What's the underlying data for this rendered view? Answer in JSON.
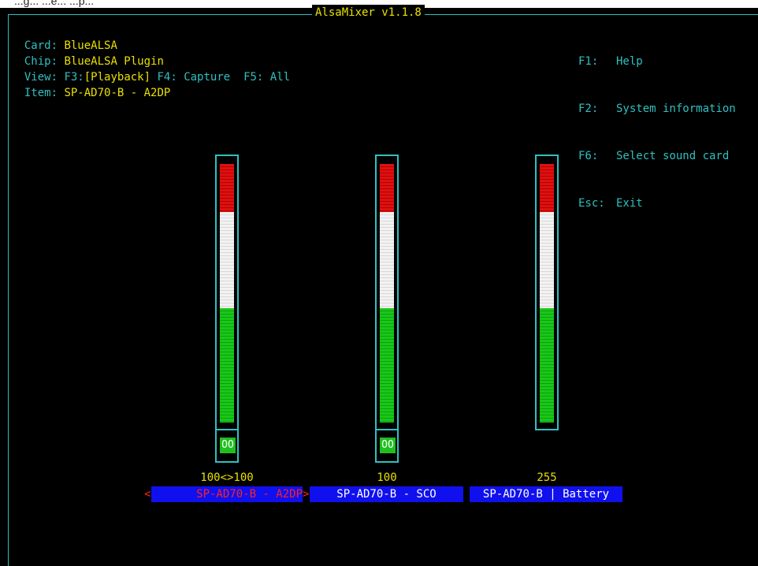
{
  "window": {
    "partial_titlebar": "...g... ...e... ...p..."
  },
  "title": "AlsaMixer v1.1.8",
  "info": {
    "card_label": "Card:",
    "card_value": "BlueALSA",
    "chip_label": "Chip:",
    "chip_value": "BlueALSA Plugin",
    "view_label": "View:",
    "view_f3_key": "F3:",
    "view_f3_value": "[Playback]",
    "view_f4": "F4: Capture",
    "view_f5": "F5: All",
    "item_label": "Item:",
    "item_value": "SP-AD70-B - A2DP"
  },
  "keys": [
    {
      "key": "F1:",
      "desc": "Help"
    },
    {
      "key": "F2:",
      "desc": "System information"
    },
    {
      "key": "F6:",
      "desc": "Select sound card"
    },
    {
      "key": "Esc:",
      "desc": "Exit"
    }
  ],
  "channels": [
    {
      "name": "SP-AD70-B - A2DP",
      "level": "100<>100",
      "volume_percent": 100,
      "mute_label": "OO",
      "selected": true
    },
    {
      "name": "SP-AD70-B - SCO",
      "level": "100",
      "volume_percent": 100,
      "mute_label": "OO",
      "selected": false
    },
    {
      "name": "SP-AD70-B | Battery",
      "level": "255",
      "volume_percent": 100,
      "selected": false
    }
  ],
  "arrows": {
    "left": "<",
    "right": ">"
  },
  "colors": {
    "cyan": "#2fc0c0",
    "yellow": "#e8e000",
    "name_bg": "#1010ee",
    "selected_text": "#ff2020",
    "green": "#19c719",
    "red": "#dd1111"
  }
}
